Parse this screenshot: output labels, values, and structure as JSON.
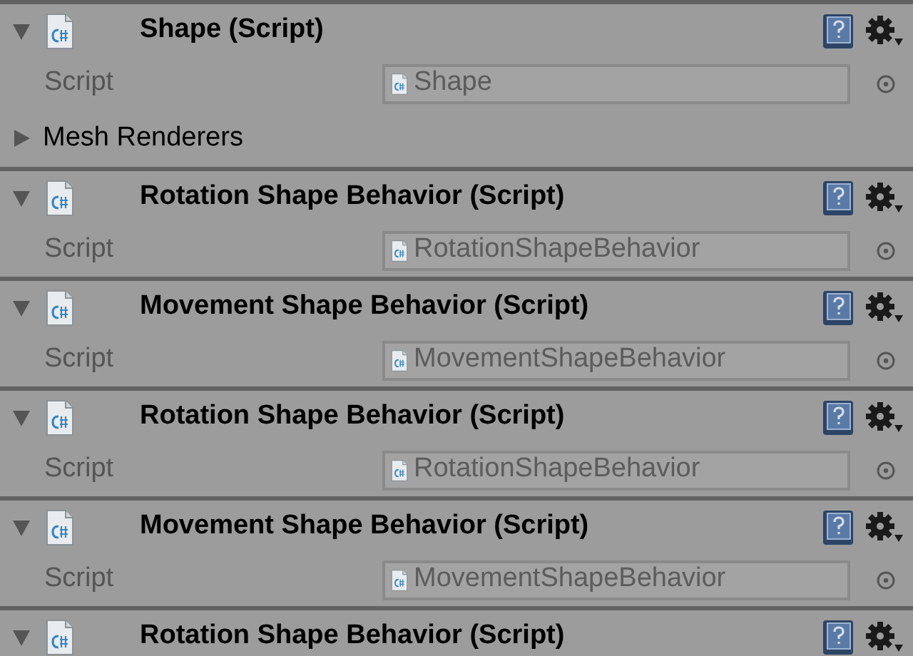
{
  "components": [
    {
      "title": "Shape (Script)",
      "expanded": true,
      "field_label": "Script",
      "field_value": "Shape",
      "foldouts": [
        {
          "label": "Mesh Renderers",
          "expanded": false
        }
      ]
    },
    {
      "title": "Rotation Shape Behavior (Script)",
      "expanded": true,
      "field_label": "Script",
      "field_value": "RotationShapeBehavior"
    },
    {
      "title": "Movement Shape Behavior (Script)",
      "expanded": true,
      "field_label": "Script",
      "field_value": "MovementShapeBehavior"
    },
    {
      "title": "Rotation Shape Behavior (Script)",
      "expanded": true,
      "field_label": "Script",
      "field_value": "RotationShapeBehavior"
    },
    {
      "title": "Movement Shape Behavior (Script)",
      "expanded": true,
      "field_label": "Script",
      "field_value": "MovementShapeBehavior"
    },
    {
      "title": "Rotation Shape Behavior (Script)",
      "expanded": true
    }
  ]
}
